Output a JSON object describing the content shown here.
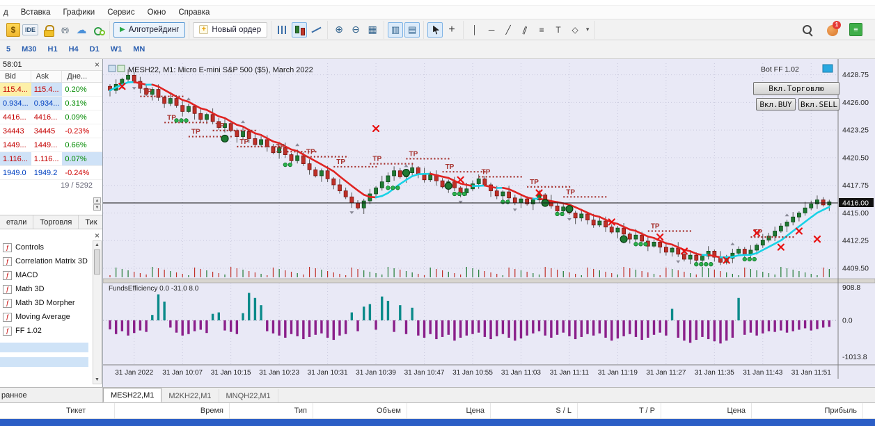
{
  "menu": {
    "items": [
      "д",
      "Вставка",
      "Графики",
      "Сервис",
      "Окно",
      "Справка"
    ]
  },
  "toolbar": {
    "groups": [
      {
        "items": [
          {
            "name": "market-watch-icon",
            "style": "dollar",
            "glyph": "$"
          },
          {
            "name": "metaeditor-ide-icon",
            "style": "idetext",
            "glyph": "IDE"
          },
          {
            "name": "lock-icon",
            "style": "lock"
          },
          {
            "name": "signal-icon",
            "style": "signal",
            "glyph": "((•))"
          },
          {
            "name": "cloud-icon",
            "style": "cloud",
            "glyph": "☁"
          },
          {
            "name": "community-icon",
            "style": "community"
          }
        ]
      },
      {
        "items": [
          {
            "name": "algo-trading-button",
            "style": "algo",
            "prefix": "▶",
            "label": "Алготрейдинг",
            "active": true
          }
        ]
      },
      {
        "items": [
          {
            "name": "new-order-button",
            "style": "neworder",
            "prefix": "+",
            "label": "Новый ордер"
          }
        ]
      },
      {
        "items": [
          {
            "name": "bar-chart-icon",
            "style": "bars"
          },
          {
            "name": "candle-chart-icon",
            "style": "candles",
            "active": true
          },
          {
            "name": "line-chart-icon",
            "style": "linechart"
          }
        ]
      },
      {
        "items": [
          {
            "name": "zoom-in-icon",
            "style": "zoom",
            "glyph": "⊕"
          },
          {
            "name": "zoom-out-icon",
            "style": "zoom",
            "glyph": "⊖"
          },
          {
            "name": "grid-icon",
            "style": "zoom",
            "glyph": "▦"
          }
        ]
      },
      {
        "items": [
          {
            "name": "indicator-window-left-icon",
            "style": "indwin",
            "glyph": "▥",
            "active": true
          },
          {
            "name": "indicator-window-right-icon",
            "style": "indwin",
            "glyph": "▤",
            "active": true
          }
        ]
      },
      {
        "items": [
          {
            "name": "cursor-icon",
            "style": "cursor",
            "active": true
          },
          {
            "name": "crosshair-icon",
            "style": "cross",
            "glyph": "+"
          }
        ]
      },
      {
        "items": [
          {
            "name": "vertical-line-icon",
            "style": "draw",
            "glyph": "│"
          },
          {
            "name": "horizontal-line-icon",
            "style": "draw",
            "glyph": "─"
          },
          {
            "name": "trendline-icon",
            "style": "draw",
            "glyph": "╱"
          },
          {
            "name": "channel-icon",
            "style": "draw rot",
            "glyph": "∥"
          },
          {
            "name": "fibonacci-icon",
            "style": "draw",
            "glyph": "≡"
          },
          {
            "name": "text-label-icon",
            "style": "draw",
            "glyph": "T"
          },
          {
            "name": "shapes-icon",
            "style": "draw",
            "glyph": "◇"
          },
          {
            "name": "dropdown-arrow-icon",
            "style": "drop",
            "glyph": "▾"
          }
        ]
      }
    ],
    "right": [
      {
        "name": "search-icon",
        "style": "searchic"
      },
      {
        "name": "notification-icon",
        "style": "bell",
        "badge": "1"
      },
      {
        "name": "levels-icon",
        "style": "levels",
        "glyph": "≡"
      }
    ]
  },
  "timeframes": {
    "items": [
      "5",
      "M30",
      "H1",
      "H4",
      "D1",
      "W1",
      "MN"
    ]
  },
  "market_watch": {
    "header_time": "58:01",
    "columns": [
      "Bid",
      "Ask",
      "Дне..."
    ],
    "rows": [
      {
        "bid": "115.4...",
        "ask": "115.4...",
        "change": "0.20%",
        "color": "red",
        "bid_hl": "yellow",
        "ask_hl": "blue"
      },
      {
        "bid": "0.934...",
        "ask": "0.934...",
        "change": "0.31%",
        "color": "blue",
        "bid_hl": "blue",
        "ask_hl": "blue"
      },
      {
        "bid": "4416...",
        "ask": "4416...",
        "change": "0.09%",
        "color": "red"
      },
      {
        "bid": "34443",
        "ask": "34445",
        "change": "-0.23%",
        "color": "red"
      },
      {
        "bid": "1449...",
        "ask": "1449...",
        "change": "0.66%",
        "color": "red"
      },
      {
        "bid": "1.116...",
        "ask": "1.116...",
        "change": "0.07%",
        "color": "red",
        "bid_hl": "blue",
        "chg_hl": "blue"
      },
      {
        "bid": "1949.0",
        "ask": "1949.2",
        "change": "-0.24%",
        "color": "blue"
      }
    ],
    "counter": "19 / 5292",
    "tabs": [
      "етали",
      "Торговля",
      "Тик"
    ]
  },
  "navigator": {
    "items": [
      "Controls",
      "Correlation Matrix 3D",
      "MACD",
      "Math 3D",
      "Math 3D Morpher",
      "Moving Average",
      "FF 1.02"
    ],
    "favorites_tab": "ранное"
  },
  "chart": {
    "symbol_title": "MESH22, M1:  Micro E-mini S&P 500 ($5), March 2022",
    "bot_label": "Bot FF 1.02",
    "buttons": {
      "trade": "Вкл.Торговлю",
      "buy": "Вкл.BUY",
      "sell": "Вкл.SELL"
    },
    "price_labels": [
      "4428.75",
      "4426.00",
      "4423.25",
      "4420.50",
      "4417.75",
      "4415.00",
      "4412.25",
      "4409.50"
    ],
    "current_price": "4416.00",
    "indicator_label": "FundsEfficiency 0.0 -31.0 8.0",
    "indicator_axis": [
      "908.8",
      "0.0",
      "-1013.8"
    ],
    "time_labels": [
      "31 Jan 2022",
      "31 Jan 10:07",
      "31 Jan 10:15",
      "31 Jan 10:23",
      "31 Jan 10:31",
      "31 Jan 10:39",
      "31 Jan 10:47",
      "31 Jan 10:55",
      "31 Jan 11:03",
      "31 Jan 11:11",
      "31 Jan 11:19",
      "31 Jan 11:27",
      "31 Jan 11:35",
      "31 Jan 11:43",
      "31 Jan 11:51"
    ]
  },
  "chart_data": {
    "type": "candlestick",
    "title": "MESH22, M1: Micro E-mini S&P 500 ($5), March 2022",
    "price_axis": {
      "min": 4408.6,
      "max": 4429.9,
      "gridlines": [
        4428.75,
        4426.0,
        4423.25,
        4420.5,
        4417.75,
        4415.0,
        4412.25,
        4409.5
      ],
      "current": 4416.0
    },
    "hist_axis": {
      "max": 908.8,
      "zero": 0.0,
      "min": -1013.8
    },
    "closes": [
      4427.2,
      4427.8,
      4428.3,
      4428.7,
      4428.1,
      4427.4,
      4426.8,
      4427.3,
      4426.5,
      4425.9,
      4426.4,
      4425.7,
      4425.1,
      4425.6,
      4424.9,
      4424.3,
      4424.8,
      4424.1,
      4423.5,
      4423.9,
      4423.2,
      4422.6,
      4423.1,
      4422.4,
      4421.8,
      4422.3,
      4421.6,
      4421.0,
      4421.5,
      4420.8,
      4420.2,
      4420.7,
      4419.9,
      4419.3,
      4418.7,
      4419.2,
      4418.4,
      4417.8,
      4417.2,
      4416.6,
      4416.0,
      4415.5,
      4416.2,
      4416.9,
      4417.5,
      4418.1,
      4418.7,
      4419.2,
      4418.6,
      4419.0,
      4419.5,
      4418.9,
      4418.3,
      4418.8,
      4418.2,
      4417.6,
      4418.1,
      4417.5,
      4417.0,
      4417.4,
      4417.9,
      4418.4,
      4417.8,
      4417.2,
      4416.7,
      4417.1,
      4416.5,
      4416.0,
      4416.4,
      4415.9,
      4416.3,
      4416.8,
      4416.2,
      4415.7,
      4415.2,
      4415.6,
      4415.0,
      4414.5,
      4414.9,
      4414.3,
      4413.8,
      4414.2,
      4413.6,
      4413.1,
      4413.5,
      4412.9,
      4412.4,
      4412.8,
      4412.2,
      4411.7,
      4412.1,
      4411.6,
      4411.1,
      4411.5,
      4410.9,
      4410.4,
      4410.8,
      4410.3,
      4410.7,
      4411.2,
      4410.6,
      4410.1,
      4410.5,
      4411.0,
      4411.4,
      4410.9,
      4411.3,
      4411.8,
      4412.3,
      4412.7,
      4413.2,
      4413.7,
      4414.1,
      4414.6,
      4415.0,
      4415.5,
      4415.9,
      4416.3,
      4415.8,
      4416.1
    ],
    "histogram": [
      -250,
      -380,
      -300,
      -420,
      -350,
      -280,
      -320,
      150,
      720,
      520,
      -200,
      -340,
      -420,
      -380,
      -300,
      -260,
      -350,
      180,
      220,
      -280,
      -320,
      -380,
      200,
      760,
      620,
      420,
      -300,
      -360,
      -420,
      -480,
      -380,
      -440,
      -520,
      -460,
      -400,
      -360,
      -480,
      -540,
      -420,
      -380,
      220,
      -300,
      380,
      450,
      -260,
      660,
      540,
      -320,
      420,
      -380,
      350,
      -420,
      -480,
      -380,
      -520,
      -460,
      -400,
      -560,
      -480,
      -420,
      -380,
      -340,
      -460,
      -520,
      -440,
      -380,
      -480,
      -560,
      -500,
      -420,
      -360,
      -300,
      -420,
      -480,
      -400,
      -340,
      -440,
      -520,
      -460,
      -380,
      -420,
      -360,
      -480,
      -560,
      -500,
      -440,
      -380,
      -460,
      -540,
      -480,
      -400,
      -340,
      -420,
      320,
      -480,
      -560,
      -620,
      -540,
      -460,
      -520,
      -580,
      -640,
      -560,
      -480,
      620,
      -400,
      -340,
      -420,
      -360,
      -300,
      -320,
      -280,
      -340,
      -300,
      -260,
      -220,
      -280,
      -240,
      -200,
      -180
    ],
    "tp_markers": [
      {
        "i": 5,
        "p": 4426.6
      },
      {
        "i": 9,
        "p": 4424.0
      },
      {
        "i": 13,
        "p": 4422.6
      },
      {
        "i": 17,
        "p": 4423.2
      },
      {
        "i": 21,
        "p": 4421.6
      },
      {
        "i": 27,
        "p": 4421.1
      },
      {
        "i": 32,
        "p": 4420.6
      },
      {
        "i": 37,
        "p": 4419.6
      },
      {
        "i": 43,
        "p": 4419.9
      },
      {
        "i": 49,
        "p": 4420.4
      },
      {
        "i": 55,
        "p": 4419.1
      },
      {
        "i": 61,
        "p": 4418.6
      },
      {
        "i": 69,
        "p": 4417.6
      },
      {
        "i": 75,
        "p": 4416.6
      },
      {
        "i": 89,
        "p": 4413.2
      },
      {
        "i": 106,
        "p": 4412.6
      }
    ],
    "x_markers": [
      {
        "i": 2,
        "p": 4427.6
      },
      {
        "i": 44,
        "p": 4423.4
      },
      {
        "i": 58,
        "p": 4418.3
      },
      {
        "i": 71,
        "p": 4417.0
      },
      {
        "i": 83,
        "p": 4414.1
      },
      {
        "i": 91,
        "p": 4412.6
      },
      {
        "i": 95,
        "p": 4411.2
      },
      {
        "i": 102,
        "p": 4410.3
      },
      {
        "i": 107,
        "p": 4413.0
      },
      {
        "i": 111,
        "p": 4411.6
      },
      {
        "i": 114,
        "p": 4413.2
      },
      {
        "i": 117,
        "p": 4412.4
      }
    ],
    "dot_clusters": [
      {
        "i": 11,
        "n": 3,
        "p": 4424.2
      },
      {
        "i": 29,
        "n": 2,
        "p": 4419.8
      },
      {
        "i": 46,
        "n": 3,
        "p": 4417.5
      },
      {
        "i": 57,
        "n": 3,
        "p": 4416.9
      },
      {
        "i": 65,
        "n": 2,
        "p": 4416.1
      },
      {
        "i": 74,
        "n": 2,
        "p": 4414.9
      },
      {
        "i": 87,
        "n": 3,
        "p": 4411.9
      },
      {
        "i": 97,
        "n": 4,
        "p": 4409.9
      },
      {
        "i": 105,
        "n": 3,
        "p": 4410.4
      }
    ],
    "entry_circles": [
      {
        "i": 19,
        "p": 4422.4
      },
      {
        "i": 49,
        "p": 4419.0
      },
      {
        "i": 56,
        "p": 4417.7
      },
      {
        "i": 72,
        "p": 4416.0
      },
      {
        "i": 76,
        "p": 4415.4
      },
      {
        "i": 85,
        "p": 4412.4
      }
    ]
  },
  "bottom": {
    "chart_tabs": [
      {
        "label": "MESH22,M1",
        "active": true
      },
      {
        "label": "M2KH22,M1"
      },
      {
        "label": "MNQH22,M1"
      }
    ],
    "trade_columns": [
      "Тикет",
      "Время",
      "Тип",
      "Объем",
      "Цена",
      "S / L",
      "T / P",
      "Цена",
      "Прибыль"
    ]
  }
}
